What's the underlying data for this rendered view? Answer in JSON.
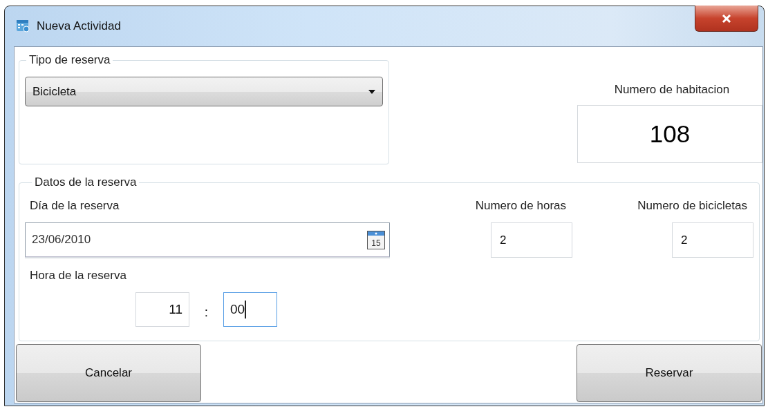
{
  "window": {
    "title": "Nueva Actividad"
  },
  "tipo_de_reserva": {
    "legend": "Tipo de reserva",
    "combo": {
      "value": "Bicicleta"
    }
  },
  "habitacion": {
    "label": "Numero de habitacion",
    "value": "108"
  },
  "datos_de_la_reserva": {
    "legend": "Datos de la reserva",
    "dia": {
      "label": "Día de la reserva",
      "value": "23/06/2010",
      "calendar_day": "15"
    },
    "horas": {
      "label": "Numero de horas",
      "value": "2"
    },
    "bicicletas": {
      "label": "Numero de bicicletas",
      "value": "2"
    },
    "hora": {
      "label": "Hora de la reserva",
      "separator": ":",
      "fields": [
        {
          "value": "11",
          "focused": false
        },
        {
          "value": "00",
          "focused": true
        }
      ]
    }
  },
  "buttons": [
    "Cancelar",
    "Reservar"
  ]
}
